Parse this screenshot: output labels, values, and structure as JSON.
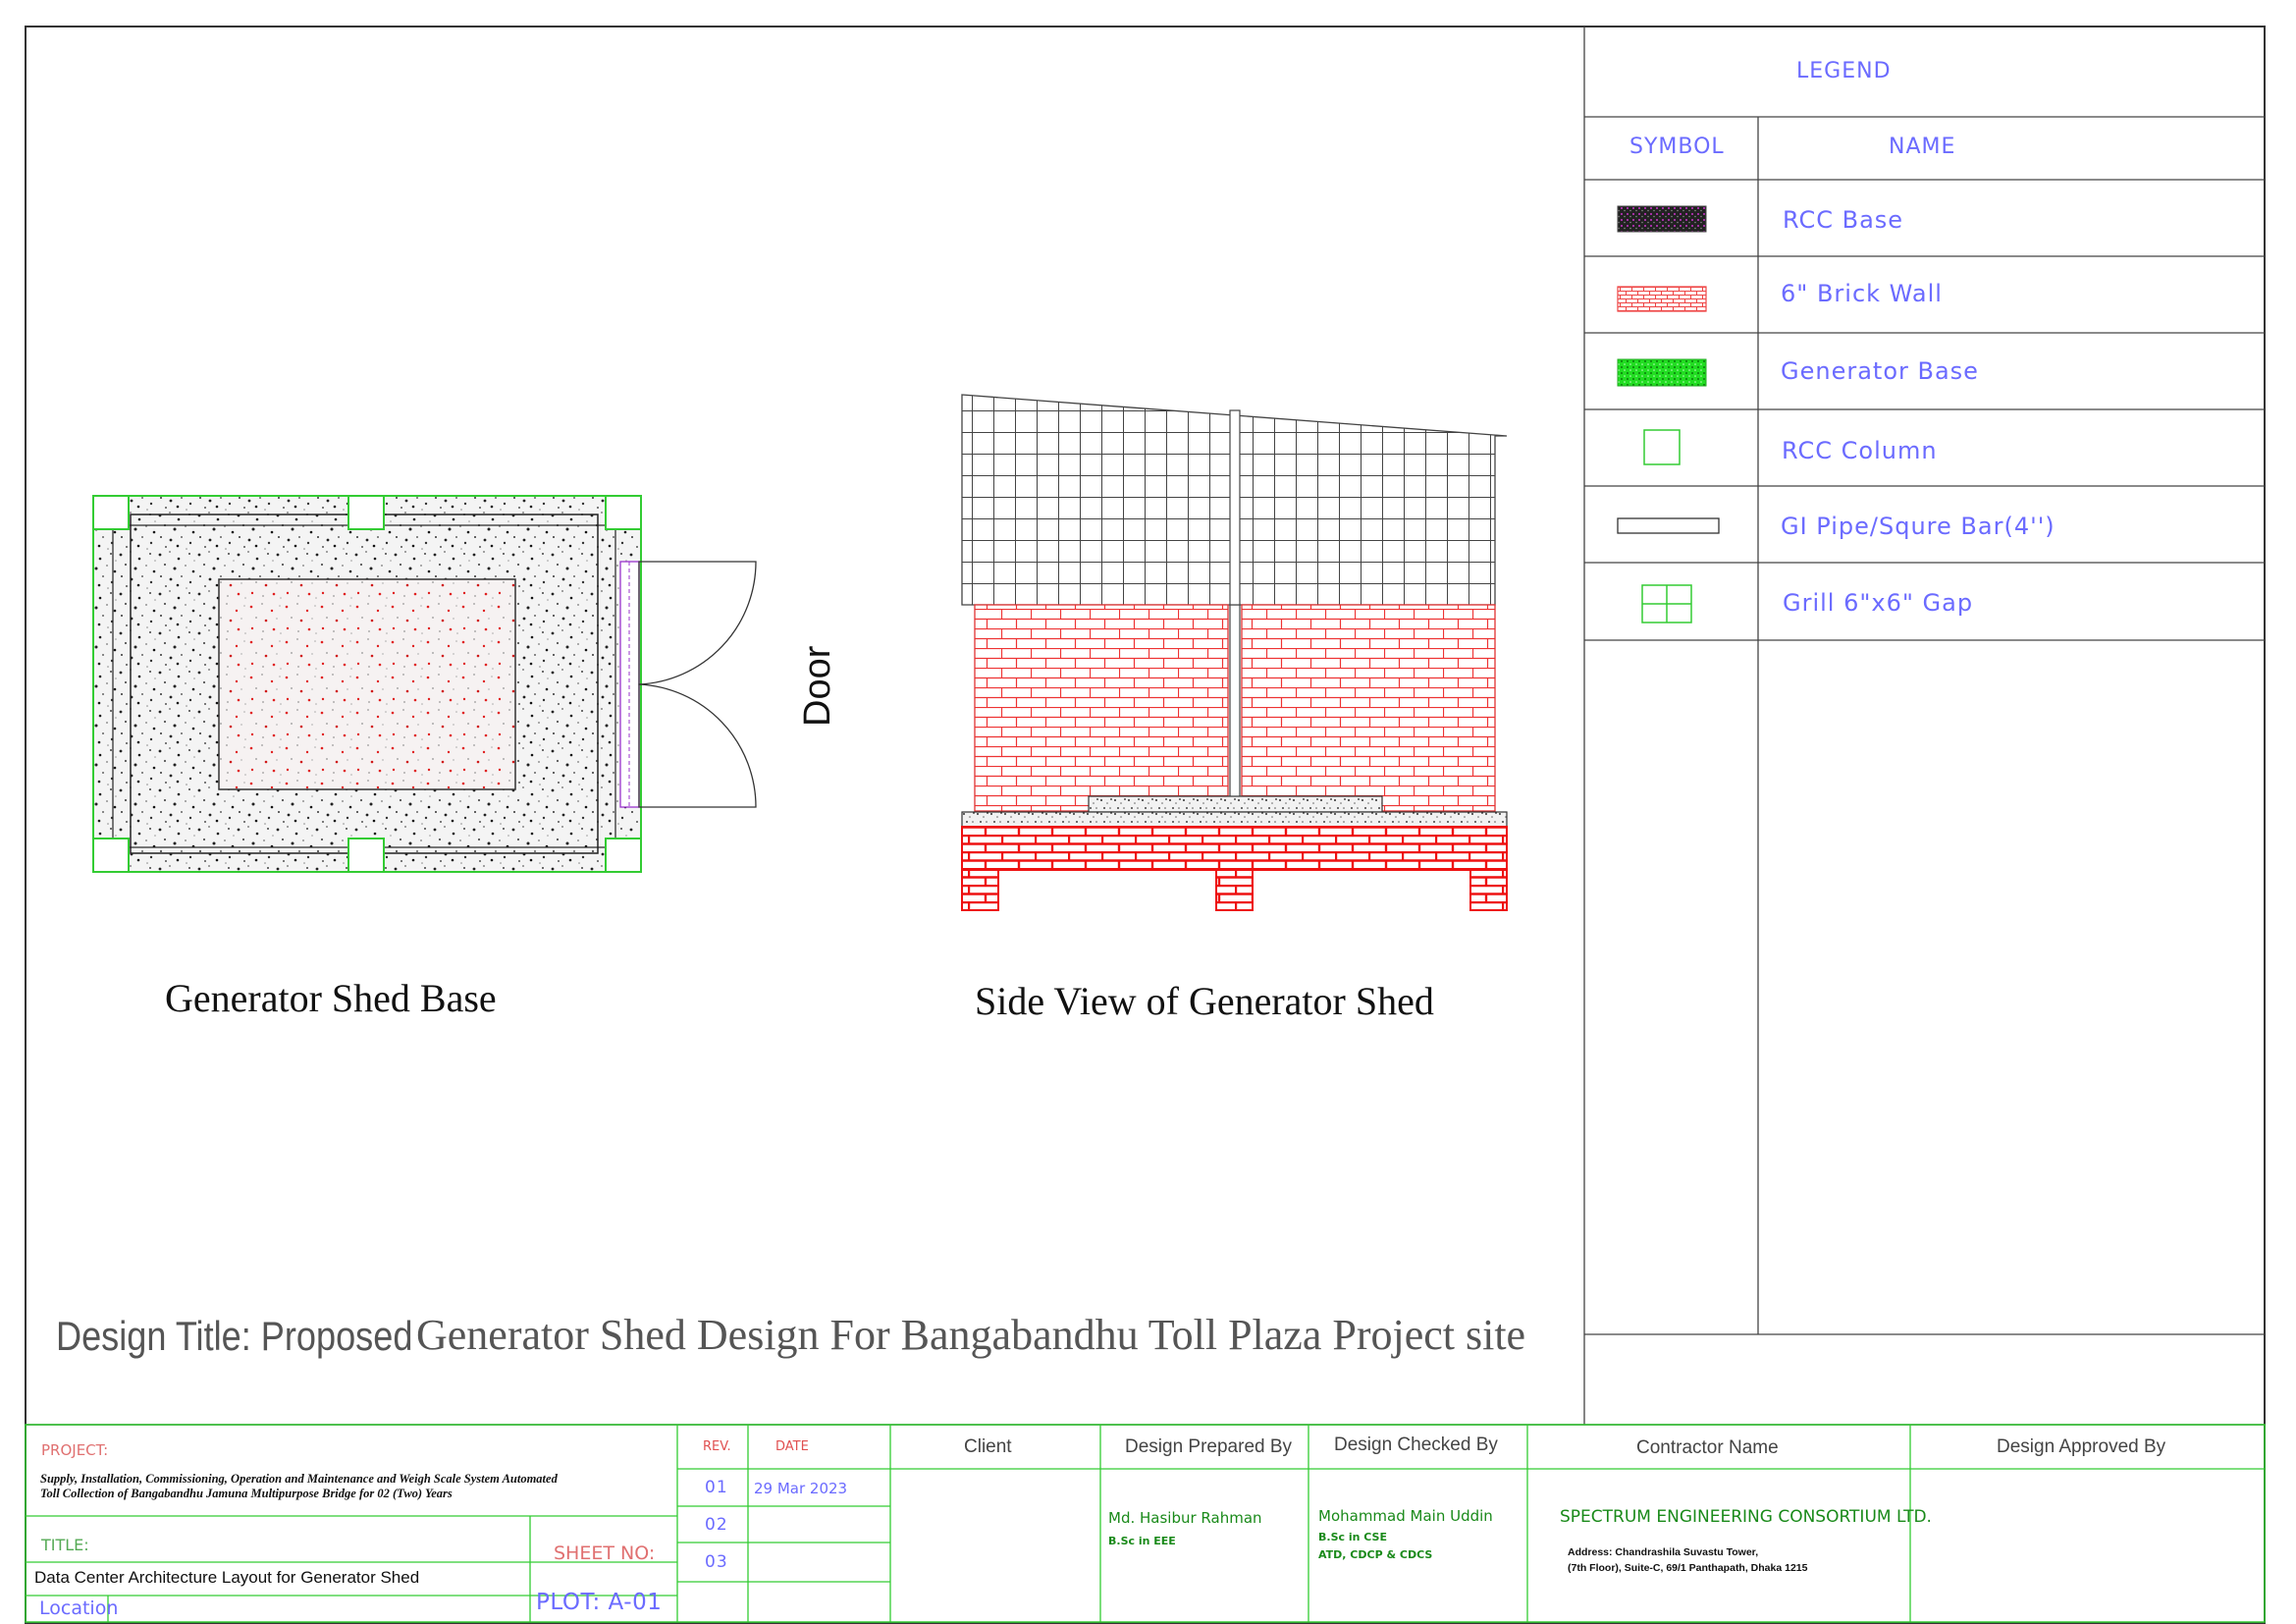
{
  "drawing": {
    "plan_title": "Generator Shed Base",
    "side_title": "Side View of Generator Shed",
    "door_label": "Door",
    "design_title_prefix": "Design Title: Proposed",
    "design_title_main": "Generator Shed Design For Bangabandhu Toll Plaza Project site"
  },
  "legend": {
    "title": "LEGEND",
    "symbol_header": "SYMBOL",
    "name_header": "NAME",
    "items": [
      {
        "name": "RCC  Base",
        "icon": "rcc-base-hatch-icon"
      },
      {
        "name": "6\"  Brick  Wall",
        "icon": "brick-wall-hatch-icon"
      },
      {
        "name": "Generator  Base",
        "icon": "generator-base-hatch-icon"
      },
      {
        "name": "RCC  Column",
        "icon": "rcc-column-square-icon"
      },
      {
        "name": "GI  Pipe/Squre  Bar(4'')",
        "icon": "gi-pipe-bar-icon"
      },
      {
        "name": "Grill  6\"x6\"  Gap",
        "icon": "grill-grid-icon"
      }
    ]
  },
  "title_block": {
    "project_label": "PROJECT:",
    "project_line1": "Supply, Installation, Commissioning, Operation and Maintenance and Weigh Scale System Automated",
    "project_line2": "Toll Collection of Bangabandhu Jamuna Multipurpose Bridge for 02 (Two) Years",
    "title_label": "TITLE:",
    "title_value": "Data Center Architecture Layout for Generator Shed",
    "location_label": "Location",
    "sheet_no_label": "SHEET  NO:",
    "plot_label": "PLOT:  A-01",
    "rev_header": "REV.",
    "date_header": "DATE",
    "revisions": [
      {
        "rev": "01",
        "date": "29  Mar  2023"
      },
      {
        "rev": "02",
        "date": ""
      },
      {
        "rev": "03",
        "date": ""
      }
    ],
    "client_header": "Client",
    "prepared_header": "Design Prepared By",
    "prepared_name": "Md.  Hasibur  Rahman",
    "prepared_degree": "B.Sc  in  EEE",
    "checked_header": "Design Checked By",
    "checked_name": "Mohammad  Main  Uddin",
    "checked_degree1": "B.Sc  in  CSE",
    "checked_degree2": "ATD,  CDCP  &  CDCS",
    "contractor_header": "Contractor Name",
    "contractor_name": "SPECTRUM  ENGINEERING  CONSORTIUM  LTD.",
    "contractor_address1": "Address:  Chandrashila  Suvastu  Tower,",
    "contractor_address2": "(7th  Floor),  Suite-C,  69/1  Panthapath,  Dhaka  1215",
    "approved_header": "Design Approved By"
  },
  "colors": {
    "border": "#333333",
    "green_line": "#33cc33",
    "brick_red": "#ee2222",
    "legend_text": "#6b6bff",
    "signature_green": "#1a8a1a"
  }
}
